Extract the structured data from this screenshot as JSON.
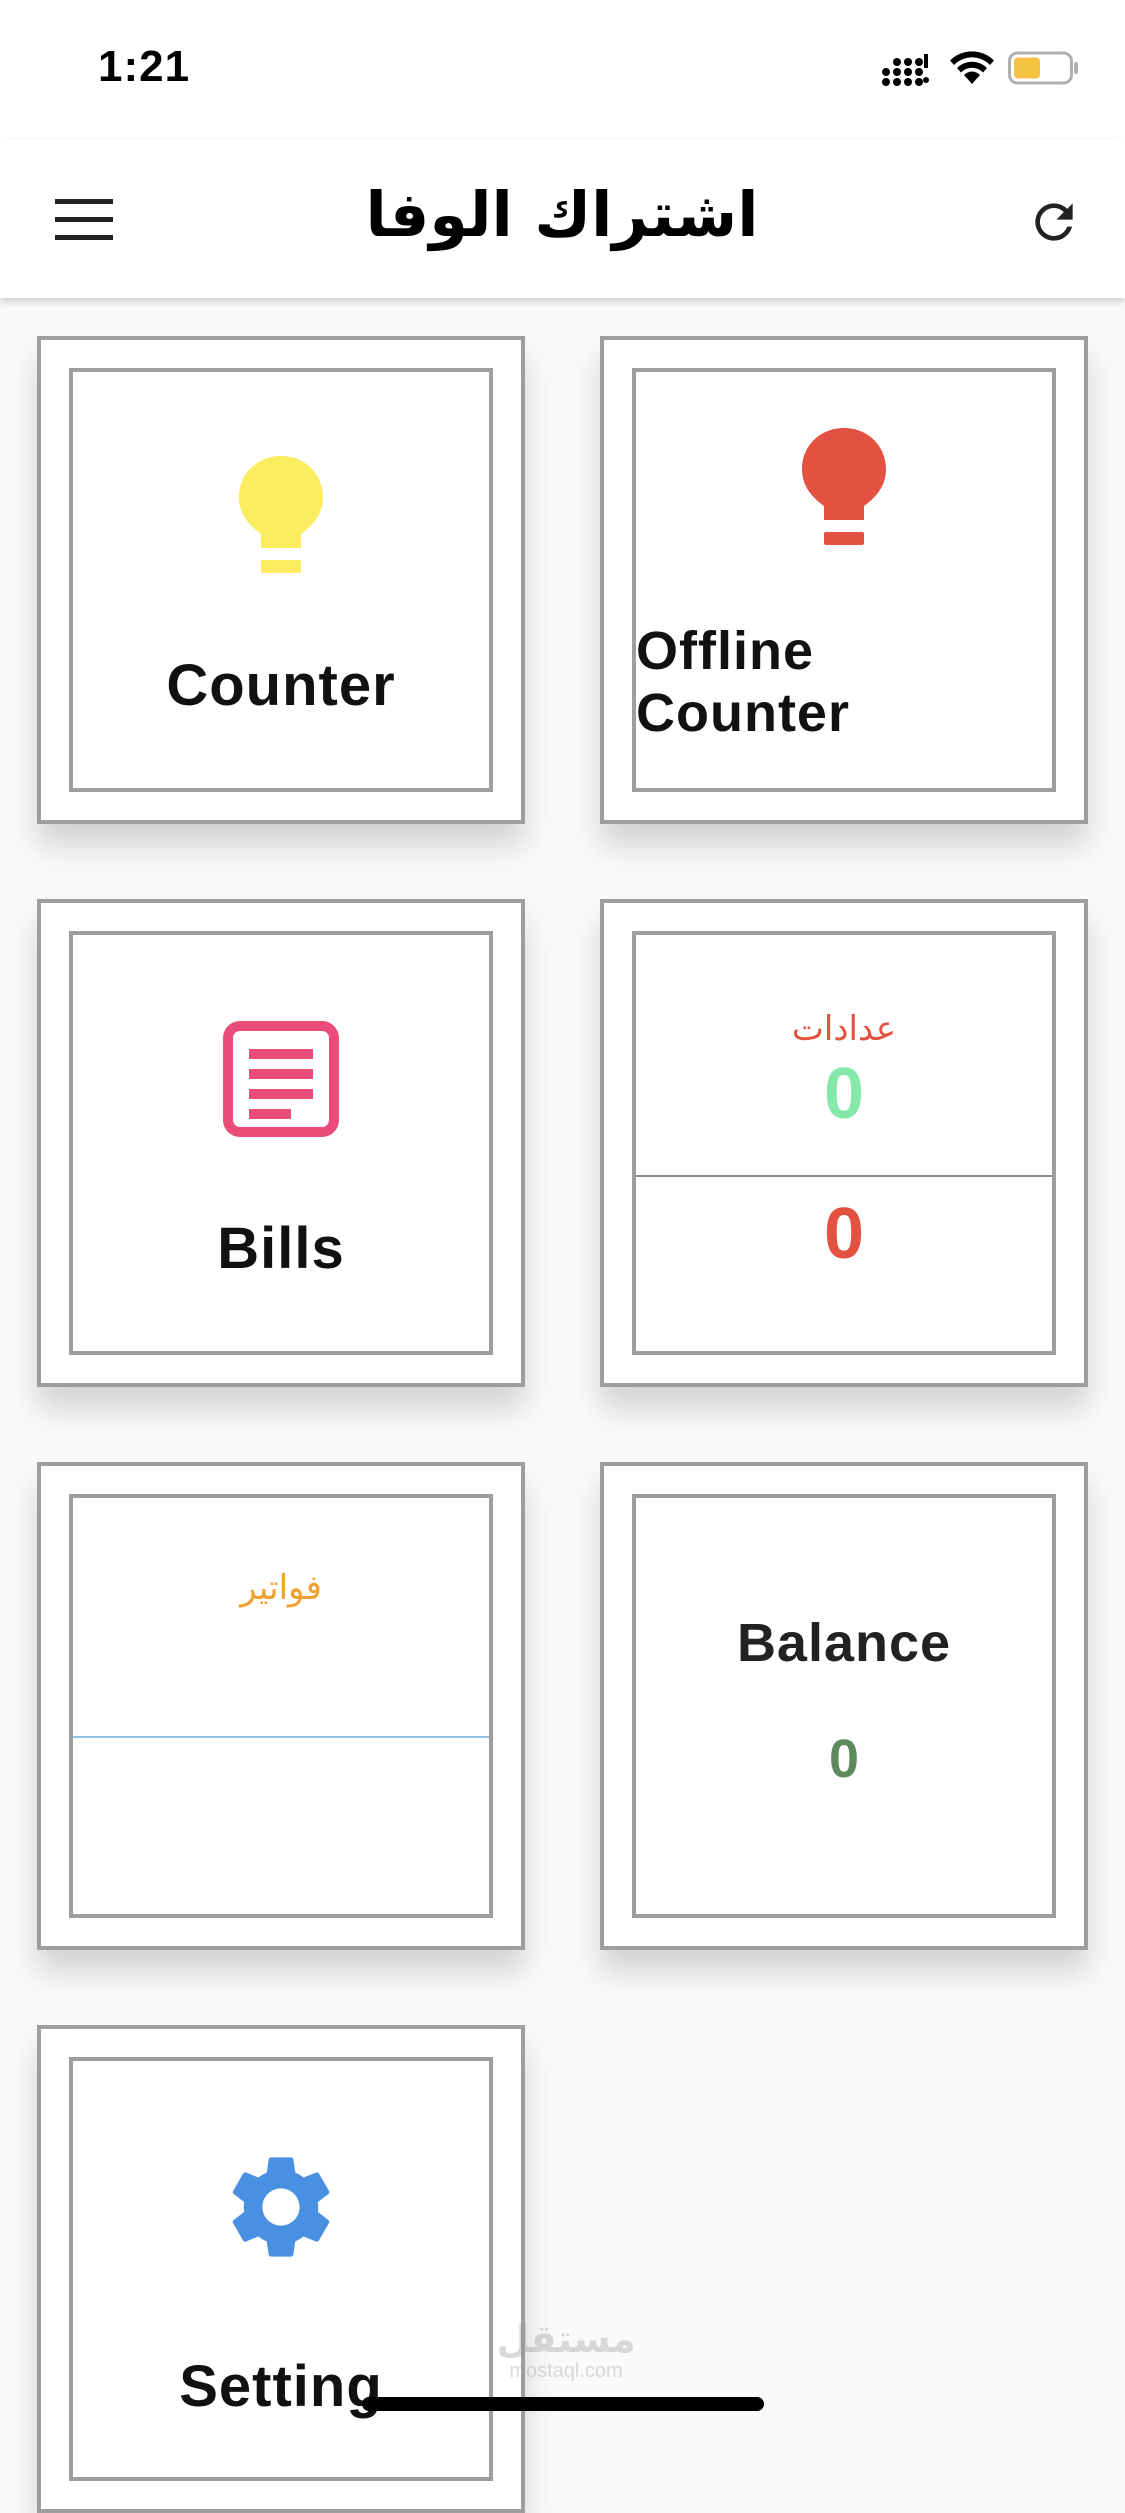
{
  "status_bar": {
    "time": "1:21",
    "battery_color": "#f5c342"
  },
  "app_bar": {
    "title": "اشتراك الوفا",
    "menu_icon": "hamburger-menu-icon",
    "refresh_icon": "refresh-icon"
  },
  "tiles": {
    "counter": {
      "label": "Counter",
      "icon": "lightbulb-icon",
      "icon_color": "#fcec60"
    },
    "offline_counter": {
      "label_line1": "Offline",
      "label_line2": "Counter",
      "icon": "lightbulb-icon",
      "icon_color": "#e35241"
    },
    "bills": {
      "label": "Bills",
      "icon": "receipt-icon",
      "icon_color": "#ea4d7a"
    },
    "meters_stats": {
      "title": "عدادات",
      "title_color": "#e35241",
      "top_value": "0",
      "top_value_color": "#86e8a8",
      "bottom_value": "0",
      "bottom_value_color": "#e35241"
    },
    "invoices_stats": {
      "title": "فواتير",
      "title_color": "#f0a030",
      "divider_color": "#8fc4ea"
    },
    "balance": {
      "label": "Balance",
      "value": "0",
      "value_color": "#5e8a5e"
    },
    "setting": {
      "label": "Setting",
      "icon": "gear-icon",
      "icon_color": "#4a90e2"
    }
  },
  "watermark": {
    "arabic": "مستقل",
    "latin": "mostaql.com"
  }
}
